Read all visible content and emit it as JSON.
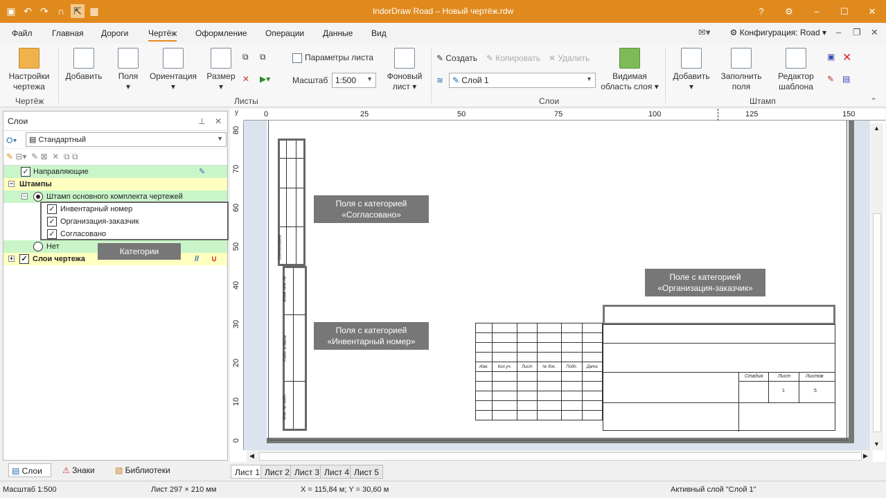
{
  "window": {
    "title": "IndorDraw Road – Новый чертёж.rdw",
    "accent": "#e08a1e"
  },
  "menu": {
    "items": [
      "Файл",
      "Главная",
      "Дороги",
      "Чертёж",
      "Оформление",
      "Операции",
      "Данные",
      "Вид"
    ],
    "active": "Чертёж",
    "config": "Конфигурация: Road"
  },
  "ribbon": {
    "drawing_group": {
      "name": "Чертёж",
      "settings": "Настройки чертежа"
    },
    "sheets_group": {
      "name": "Листы",
      "add": "Добавить",
      "fields": "Поля",
      "orientation": "Ориентация",
      "size": "Размер",
      "sheet_params": "Параметры листа",
      "scale_label": "Масштаб",
      "scale_value": "1:500",
      "background": "Фоновый лист"
    },
    "layers_group": {
      "name": "Слои",
      "create": "Создать",
      "copy": "Копировать",
      "delete": "Удалить",
      "layer_value": "Слой 1",
      "visible_area": "Видимая область слоя"
    },
    "stamp_group": {
      "name": "Штамп",
      "add": "Добавить",
      "fill": "Заполнить поля",
      "editor": "Редактор шаблона"
    }
  },
  "layers_panel": {
    "title": "Слои",
    "preset": "Стандартный",
    "tree": [
      {
        "label": "Направляющие",
        "type": "checkbox",
        "checked": true,
        "bg": "#c9f5c9"
      },
      {
        "label": "Штампы",
        "type": "group",
        "bg": "#ffffc0"
      },
      {
        "label": "Штамп основного комплекта чертежей",
        "type": "radio",
        "checked": true,
        "bg": "#c9f5c9"
      },
      {
        "label": "Инвентарный номер",
        "type": "checkbox",
        "checked": true,
        "bg": "#ffffff"
      },
      {
        "label": "Организация-заказчик",
        "type": "checkbox",
        "checked": true,
        "bg": "#ffffff"
      },
      {
        "label": "Согласовано",
        "type": "checkbox",
        "checked": true,
        "bg": "#ffffff"
      },
      {
        "label": "Нет",
        "type": "radio",
        "checked": false,
        "bg": "#c9f5c9"
      },
      {
        "label": "Слои чертежа",
        "type": "checkbox",
        "checked": true,
        "bg": "#ffffc0"
      }
    ],
    "tabs": [
      "Слои",
      "Знаки",
      "Библиотеки"
    ]
  },
  "callouts": {
    "categories": "Категории",
    "agreed": "Поля с категорией «Согласовано»",
    "inventory": "Поля с категорией «Инвентарный номер»",
    "customer": "Поле с категорией «Организация-заказчик»"
  },
  "rulers": {
    "top": [
      "0",
      "25",
      "50",
      "75",
      "100",
      "125",
      "150"
    ],
    "left": [
      "80",
      "70",
      "60",
      "50",
      "40",
      "30",
      "20",
      "10",
      "0"
    ]
  },
  "stamp": {
    "side_labels": [
      "Согласовано",
      "Взам. инв. №",
      "Подп. и дата",
      "Инв. № подл."
    ],
    "header": [
      "Изм.",
      "Кол.уч.",
      "Лист",
      "№ док.",
      "Подп.",
      "Дата"
    ],
    "info_header": [
      "Стадия",
      "Лист",
      "Листов"
    ],
    "info_values": [
      "",
      "1",
      "5"
    ]
  },
  "sheet_tabs": [
    "Лист 1",
    "Лист 2",
    "Лист 3",
    "Лист 4",
    "Лист 5"
  ],
  "status": {
    "scale": "Масштаб 1:500",
    "sheet": "Лист 297 × 210 мм",
    "coords": "X = 115,84 м; Y = 30,60 м",
    "active_layer": "Активный слой \"Слой 1\""
  }
}
